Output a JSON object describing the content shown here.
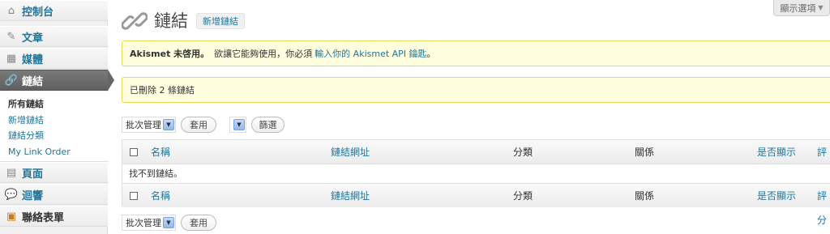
{
  "sidebar": {
    "items": [
      {
        "label": "控制台",
        "icon": "dashboard-icon"
      },
      {
        "label": "文章",
        "icon": "pin-icon"
      },
      {
        "label": "媒體",
        "icon": "media-icon"
      },
      {
        "label": "鏈結",
        "icon": "link-icon"
      },
      {
        "label": "頁面",
        "icon": "page-icon"
      },
      {
        "label": "迴響",
        "icon": "comment-icon"
      },
      {
        "label": "聯絡表單",
        "icon": "form-icon"
      }
    ],
    "submenu": [
      "所有鏈結",
      "新增鏈結",
      "鏈結分類",
      "My Link Order"
    ]
  },
  "header": {
    "title": "鏈結",
    "add_new": "新增鏈結",
    "screen_options": "顯示選項"
  },
  "notices": {
    "akismet_bold": "Akismet 未啓用。",
    "akismet_text": "欲讓它能夠使用，你必須",
    "akismet_link": "輸入你的 Akismet API 鑰匙",
    "akismet_end": "。",
    "deleted": "已刪除 2 條鏈結"
  },
  "bulk": {
    "select_value": "批次管理",
    "apply": "套用",
    "filter": "篩選"
  },
  "table": {
    "columns": [
      "名稱",
      "鏈結網址",
      "分類",
      "關係",
      "是否顯示",
      "評分"
    ],
    "empty": "找不到鏈結。"
  },
  "colors": {
    "link": "#21759b",
    "notice_bg": "#ffffe0",
    "notice_border": "#e6db55",
    "active_menu": "#6d6d6d"
  }
}
